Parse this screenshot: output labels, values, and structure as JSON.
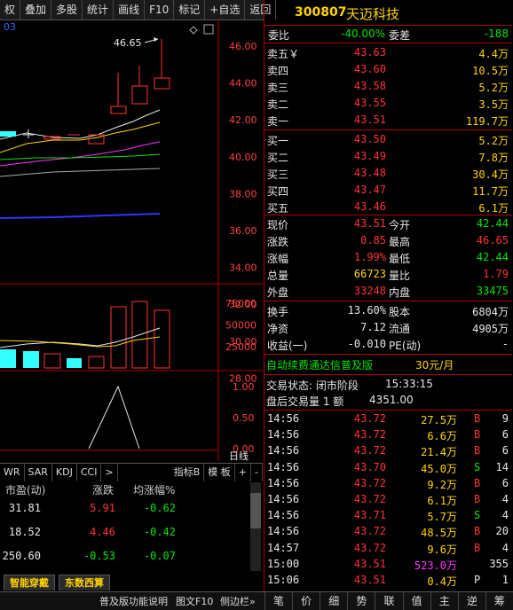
{
  "toolbar": {
    "items": [
      "权",
      "叠加",
      "多股",
      "统计",
      "画线",
      "F10",
      "标记",
      "+自选",
      "返回"
    ]
  },
  "chart": {
    "price_axis": [
      "46.00",
      "44.00",
      "42.00",
      "40.00",
      "38.00",
      "36.00",
      "34.00",
      "32.00",
      "30.00",
      "28.00"
    ],
    "max_label": "46.65",
    "vol_axis": [
      "75000",
      "50000",
      "25000"
    ],
    "ind_axis": [
      "1.00",
      "0.50",
      "0.00"
    ],
    "day_label": "日线"
  },
  "indicator_tabs": {
    "items": [
      "WR",
      "SAR",
      "KDJ",
      "CCI",
      ">"
    ],
    "right": [
      "指标B",
      "模 板",
      "+",
      "-"
    ]
  },
  "bottom_left": {
    "headers": [
      "市盈(动)",
      "涨跌",
      "均涨幅%"
    ],
    "rows": [
      {
        "pe": "31.81",
        "chg": "5.91",
        "avg": "-0.62"
      },
      {
        "pe": "18.52",
        "chg": "4.46",
        "avg": "-0.42"
      },
      {
        "pe": "250.60",
        "chg": "-0.53",
        "avg": "-0.07"
      }
    ],
    "tabs": [
      "智能穿戴",
      "东数西算"
    ]
  },
  "stock": {
    "code": "300807",
    "name": "天迈科技"
  },
  "weibi": {
    "label": "委比",
    "value": "-40.00%",
    "label2": "委差",
    "value2": "-188"
  },
  "asks": [
    {
      "label": "卖五￥",
      "price": "43.63",
      "vol": "4.4万"
    },
    {
      "label": "卖四",
      "price": "43.60",
      "vol": "10.5万"
    },
    {
      "label": "卖三",
      "price": "43.58",
      "vol": "5.2万"
    },
    {
      "label": "卖二",
      "price": "43.55",
      "vol": "3.5万"
    },
    {
      "label": "卖一",
      "price": "43.51",
      "vol": "119.7万"
    }
  ],
  "bids": [
    {
      "label": "买一",
      "price": "43.50",
      "vol": "5.2万"
    },
    {
      "label": "买二",
      "price": "43.49",
      "vol": "7.8万"
    },
    {
      "label": "买三",
      "price": "43.48",
      "vol": "30.4万"
    },
    {
      "label": "买四",
      "price": "43.47",
      "vol": "11.7万"
    },
    {
      "label": "买五",
      "price": "43.46",
      "vol": "6.1万"
    }
  ],
  "quote": [
    {
      "l1": "现价",
      "v1": "43.51",
      "c1": "red",
      "l2": "今开",
      "v2": "42.44",
      "c2": "green"
    },
    {
      "l1": "涨跌",
      "v1": "0.85",
      "c1": "red",
      "l2": "最高",
      "v2": "46.65",
      "c2": "red"
    },
    {
      "l1": "涨幅",
      "v1": "1.99%",
      "c1": "red",
      "l2": "最低",
      "v2": "42.44",
      "c2": "green"
    },
    {
      "l1": "总量",
      "v1": "66723",
      "c1": "yellow",
      "l2": "量比",
      "v2": "1.79",
      "c2": "red"
    },
    {
      "l1": "外盘",
      "v1": "33248",
      "c1": "red",
      "l2": "内盘",
      "v2": "33475",
      "c2": "green"
    }
  ],
  "fund": [
    {
      "l1": "换手",
      "v1": "13.60%",
      "l2": "股本",
      "v2": "6804万"
    },
    {
      "l1": "净资",
      "v1": "7.12",
      "l2": "流通",
      "v2": "4905万"
    },
    {
      "l1": "收益(一)",
      "v1": "-0.010",
      "l2": "PE(动)",
      "v2": "-"
    }
  ],
  "promo": {
    "text": "自动续费通达信普及版",
    "price": "30元/月"
  },
  "status": {
    "label": "交易状态: 闭市阶段",
    "time": "15:33:15"
  },
  "after_hours": {
    "label": "盘后交易量 1 额",
    "value": "4351.00"
  },
  "ticks": [
    {
      "time": "14:56",
      "price": "43.72",
      "vol": "27.5万",
      "side": "B",
      "n": "9"
    },
    {
      "time": "14:56",
      "price": "43.72",
      "vol": "6.6万",
      "side": "B",
      "n": "6"
    },
    {
      "time": "14:56",
      "price": "43.72",
      "vol": "21.4万",
      "side": "B",
      "n": "6"
    },
    {
      "time": "14:56",
      "price": "43.70",
      "vol": "45.0万",
      "side": "S",
      "n": "14"
    },
    {
      "time": "14:56",
      "price": "43.72",
      "vol": "9.2万",
      "side": "B",
      "n": "6"
    },
    {
      "time": "14:56",
      "price": "43.72",
      "vol": "6.1万",
      "side": "B",
      "n": "4"
    },
    {
      "time": "14:56",
      "price": "43.71",
      "vol": "5.7万",
      "side": "S",
      "n": "4"
    },
    {
      "time": "14:56",
      "price": "43.72",
      "vol": "48.5万",
      "side": "B",
      "n": "20"
    },
    {
      "time": "14:57",
      "price": "43.72",
      "vol": "9.6万",
      "side": "B",
      "n": "4"
    },
    {
      "time": "15:00",
      "price": "43.51",
      "vol": "523.0万",
      "side": "",
      "n": "355"
    },
    {
      "time": "15:06",
      "price": "43.51",
      "vol": "0.4万",
      "side": "P",
      "n": "1"
    }
  ],
  "statusbar": {
    "left": "普及版功能说明",
    "mid": "图文F10",
    "right": "侧边栏»"
  },
  "bottom_nav": [
    "笔",
    "价",
    "细",
    "势",
    "联",
    "值",
    "主",
    "逆",
    "筹"
  ]
}
